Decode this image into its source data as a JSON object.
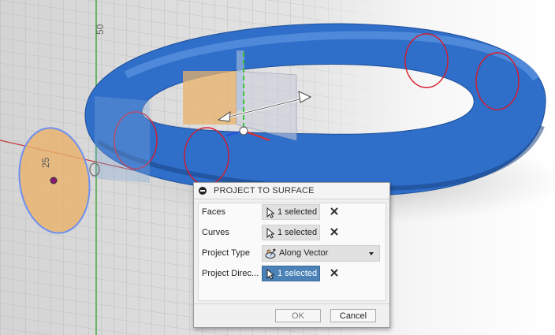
{
  "viewport": {
    "dimension_labels": [
      "50",
      "25"
    ],
    "colors": {
      "torus": "#2f6ec9",
      "grid_bg": "#d9d9d9",
      "profile_fill": "#e8b26a",
      "profile_outline": "#6f8ff0",
      "curve_red": "#d41c2c"
    }
  },
  "dialog": {
    "title": "PROJECT TO SURFACE",
    "rows": [
      {
        "label": "Faces",
        "value": "1 selected",
        "icon": "select-arrow-icon",
        "active": false
      },
      {
        "label": "Curves",
        "value": "1 selected",
        "icon": "select-arrow-icon",
        "active": false
      },
      {
        "label": "Project Type",
        "value": "Along Vector",
        "icon": "along-vector-icon"
      },
      {
        "label": "Project Direc...",
        "value": "1 selected",
        "icon": "select-arrow-icon",
        "active": true
      }
    ],
    "ok_label": "OK",
    "cancel_label": "Cancel"
  }
}
